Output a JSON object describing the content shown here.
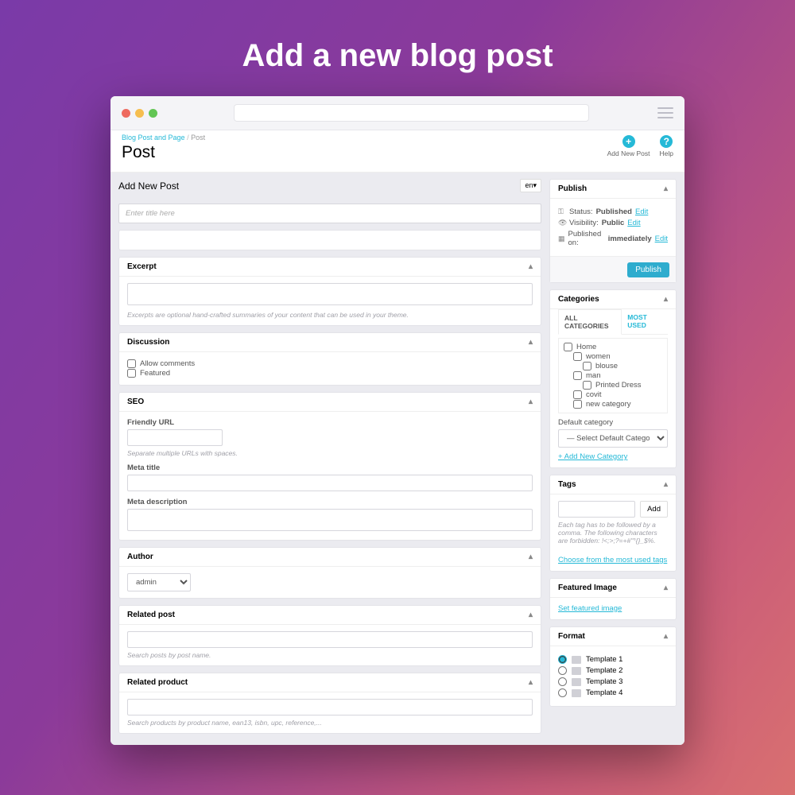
{
  "hero": "Add a new blog post",
  "breadcrumb": {
    "root": "Blog Post and Page",
    "current": "Post"
  },
  "page_title": "Post",
  "topactions": {
    "add": "Add New Post",
    "help": "Help"
  },
  "addnew_heading": "Add New Post",
  "lang": "en▾",
  "title_placeholder": "Enter title here",
  "excerpt": {
    "title": "Excerpt",
    "hint": "Excerpts are optional hand-crafted summaries of your content that can be used in your theme."
  },
  "discussion": {
    "title": "Discussion",
    "allow": "Allow comments",
    "featured": "Featured"
  },
  "seo": {
    "title": "SEO",
    "friendly_label": "Friendly URL",
    "friendly_hint": "Separate multiple URLs with spaces.",
    "meta_title": "Meta title",
    "meta_desc": "Meta description"
  },
  "author": {
    "title": "Author",
    "value": "admin"
  },
  "related_post": {
    "title": "Related post",
    "hint": "Search posts by post name."
  },
  "related_product": {
    "title": "Related product",
    "hint": "Search products by product name, ean13, isbn, upc, reference,..."
  },
  "publish": {
    "title": "Publish",
    "status_label": "Status:",
    "status_value": "Published",
    "vis_label": "Visibility:",
    "vis_value": "Public",
    "date_label": "Published on:",
    "date_value": "immediately",
    "edit": "Edit",
    "button": "Publish"
  },
  "categories": {
    "title": "Categories",
    "tab_all": "ALL CATEGORIES",
    "tab_most": "MOST USED",
    "items": [
      "Home",
      "women",
      "blouse",
      "man",
      "Printed Dress",
      "covit",
      "new category"
    ],
    "default_label": "Default category",
    "default_placeholder": "— Select Default Category —",
    "add_new": "+ Add New Category"
  },
  "tags": {
    "title": "Tags",
    "add": "Add",
    "hint": "Each tag has to be followed by a comma. The following characters are forbidden: !<;>;?=+#\"°{}_$%.",
    "choose": "Choose from the most used tags"
  },
  "featured_image": {
    "title": "Featured Image",
    "set": "Set featured image"
  },
  "format": {
    "title": "Format",
    "options": [
      "Template 1",
      "Template 2",
      "Template 3",
      "Template 4"
    ]
  }
}
